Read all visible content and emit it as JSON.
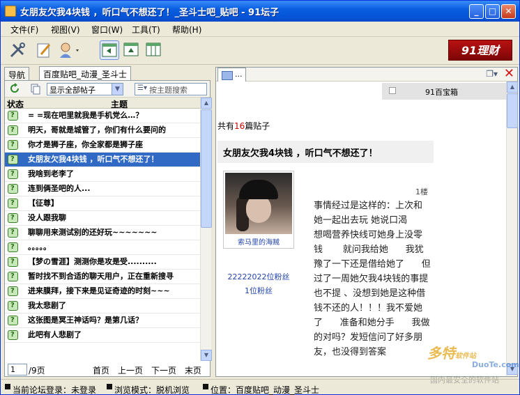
{
  "window": {
    "title": "女朋友欠我4块钱 ，听口气不想还了！_圣斗士吧_贴吧  - 91坛子"
  },
  "menu": [
    "文件(F)",
    "视图(V)",
    "窗口(W)",
    "工具(T)",
    "帮助(H)"
  ],
  "toolbar": {
    "icons": [
      "tools-icon",
      "edit-icon",
      "user-icon",
      "split-left-icon",
      "split-top-icon",
      "split-columns-icon"
    ],
    "logo": "91理财"
  },
  "left": {
    "tabs": [
      "导航",
      "百度贴吧_动漫_圣斗士"
    ],
    "filter": {
      "selected": "显示全部帖子",
      "search_placeholder": "按主题搜索"
    },
    "columns": {
      "status": "状态",
      "subject": "主题"
    },
    "rows": [
      "= =现在吧里就我是手机党么…？",
      "明天，哥就是城管了，你们有什么要问的",
      "你才是狮子座，你全家都是狮子座",
      "女朋友欠我4块钱 ，听口气不想还了！",
      "我啥到老李了",
      "连到俩圣吧的人...",
      "【征尊】",
      "没人跟我聊",
      "聊聊用来测试别的还好玩~~~~~~~",
      "。。。。。",
      "【梦の雪涯】测测你是攻是受..........",
      "暂时找不到合适的聊天用户，正在重新搜寻",
      "进来膜拜，接下来是见证奇迹的时刻~~~",
      "我太悲剧了",
      "这张图是冥王神话吗？是第几话？",
      "此吧有人悲剧了"
    ],
    "selected_row": 3,
    "pager": {
      "current": "1",
      "total": "/9页",
      "first": "首页",
      "prev": "上一页",
      "next": "下一页",
      "last": "末页"
    }
  },
  "right": {
    "tab_label": "...",
    "box_label": "91百宝箱",
    "count_prefix": "共有",
    "count_value": "16",
    "count_suffix": "篇贴子",
    "post_title": "女朋友欠我4块钱 ，听口气不想还了！",
    "floor": "1楼",
    "author_name": "索马里的海贼",
    "fans_line1": "22222022位粉丝",
    "fans_line2": "1位粉丝",
    "body": "事情经过是这样的：上次和她一起出去玩 她说口渴      想喝营养快线可她身上没零钱       就问我给她      我犹豫了一下还是借给她了      但过了一周她欠我4块钱的事提也不提 、没想到她是这种借钱不还的人！！！我不爱她了      准备和她分手      我做的对吗？发短信问了好多朋友，也没得到答案"
  },
  "statusbar": {
    "login": "当前论坛登录：未登录",
    "mode": "浏览模式：脱机浏览",
    "location": "位置：百度贴吧_动漫_圣斗士"
  },
  "watermark": {
    "brand": "多特",
    "sub": "软件站",
    "url": "DuoTe.com",
    "slogan": "国内最安全的软件站"
  }
}
